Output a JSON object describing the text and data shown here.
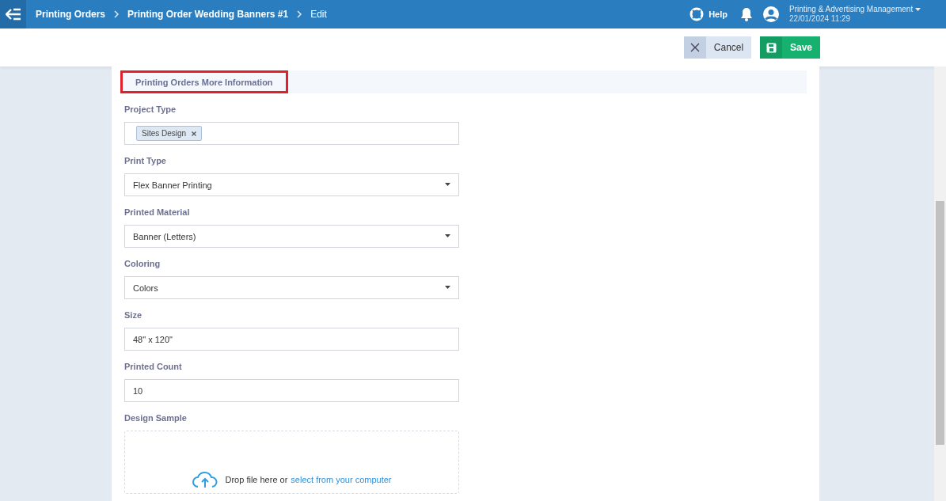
{
  "breadcrumb": [
    {
      "label": "Printing Orders"
    },
    {
      "label": "Printing Order Wedding Banners #1"
    },
    {
      "label": "Edit"
    }
  ],
  "header": {
    "help": "Help",
    "user": "Printing & Advertising Management",
    "datetime": "22/01/2024 11:29"
  },
  "actions": {
    "cancel": "Cancel",
    "save": "Save"
  },
  "section_tab": {
    "label": "Printing Orders More Information",
    "highlighted": true
  },
  "fields": [
    {
      "kind": "tags",
      "label": "Project Type",
      "tags": [
        "Sites Design"
      ]
    },
    {
      "kind": "select",
      "label": "Print Type",
      "value": "Flex Banner Printing"
    },
    {
      "kind": "select",
      "label": "Printed Material",
      "value": "Banner (Letters)"
    },
    {
      "kind": "select",
      "label": "Coloring",
      "value": "Colors"
    },
    {
      "kind": "text",
      "label": "Size",
      "value": "48\" x 120\""
    },
    {
      "kind": "text",
      "label": "Printed Count",
      "value": "10"
    }
  ],
  "upload": {
    "label": "Design Sample",
    "text": "Drop file here or",
    "link": "select from your computer"
  }
}
